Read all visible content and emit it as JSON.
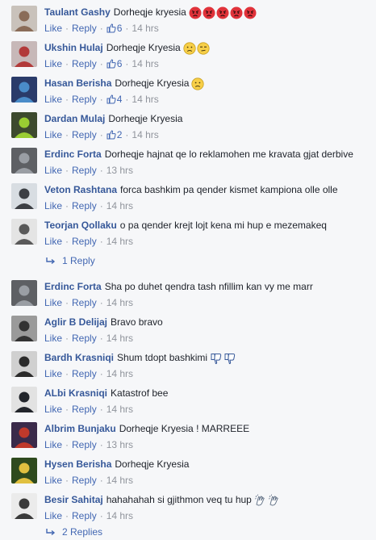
{
  "comments": [
    {
      "author": "Taulant Gashy",
      "text": "Dorheqje kryesia",
      "emojis": [
        "angry",
        "angry",
        "angry",
        "angry",
        "angry"
      ],
      "likes": "6",
      "time": "14 hrs",
      "avatar_bg": "#c9c2bb",
      "avatar_fg": "#8a6c58"
    },
    {
      "author": "Ukshin Hulaj",
      "text": "Dorheqje Kryesia",
      "emojis": [
        "sad",
        "unamused"
      ],
      "likes": "6",
      "time": "14 hrs",
      "avatar_bg": "#c7b8b8",
      "avatar_fg": "#b23a3a"
    },
    {
      "author": "Hasan Berisha",
      "text": "Dorheqje Kryesia",
      "emojis": [
        "sad"
      ],
      "likes": "4",
      "time": "14 hrs",
      "avatar_bg": "#2a3b6a",
      "avatar_fg": "#4a8cc9"
    },
    {
      "author": "Dardan Mulaj",
      "text": "Dorheqje Kryesia",
      "emojis": [],
      "likes": "2",
      "time": "14 hrs",
      "avatar_bg": "#3d4a2e",
      "avatar_fg": "#9acd32"
    },
    {
      "author": "Erdinc Forta",
      "text": "Dorheqje hajnat qe lo reklamohen me kravata gjat derbive",
      "emojis": [],
      "likes": "",
      "time": "13 hrs",
      "avatar_bg": "#5e6064",
      "avatar_fg": "#9a9ea4"
    },
    {
      "author": "Veton Rashtana",
      "text": "forca bashkim pa qender kismet kampiona olle olle",
      "emojis": [],
      "likes": "",
      "time": "14 hrs",
      "avatar_bg": "#d8dde2",
      "avatar_fg": "#3c3f44"
    },
    {
      "author": "Teorjan Qollaku",
      "text": "o pa qender krejt lojt kena mi hup e mezemakeq",
      "emojis": [],
      "likes": "",
      "time": "14 hrs",
      "avatar_bg": "#e4e4e4",
      "avatar_fg": "#5a5a5a"
    },
    {
      "author": "Erdinc Forta",
      "text": "Sha po duhet qendra tash nfillim kan vy me marr",
      "emojis": [],
      "likes": "",
      "time": "14 hrs",
      "avatar_bg": "#5e6064",
      "avatar_fg": "#9a9ea4"
    },
    {
      "author": "Aglir B Delijaj",
      "text": "Bravo bravo",
      "emojis": [],
      "likes": "",
      "time": "14 hrs",
      "avatar_bg": "#9a9a9a",
      "avatar_fg": "#333333"
    },
    {
      "author": "Bardh Krasniqi",
      "text": "Shum tdopt bashkimi",
      "emojis": [
        "thumbsdown",
        "thumbsdown"
      ],
      "likes": "",
      "time": "14 hrs",
      "avatar_bg": "#d0d0d0",
      "avatar_fg": "#2b2b2b"
    },
    {
      "author": "ALbi Krasniqi",
      "text": "Katastrof bee",
      "emojis": [],
      "likes": "",
      "time": "14 hrs",
      "avatar_bg": "#e2e2e2",
      "avatar_fg": "#22252b"
    },
    {
      "author": "Albrim Bunjaku",
      "text": "Dorheqje Kryesia ! MARREEE",
      "emojis": [],
      "likes": "",
      "time": "13 hrs",
      "avatar_bg": "#3a2a4a",
      "avatar_fg": "#c0392b"
    },
    {
      "author": "Hysen Berisha",
      "text": "Dorheqje Kryesia",
      "emojis": [],
      "likes": "",
      "time": "14 hrs",
      "avatar_bg": "#2e4a1e",
      "avatar_fg": "#e0c040"
    },
    {
      "author": "Besir Sahitaj",
      "text": "hahahahah si gjithmon veq tu hup",
      "emojis": [
        "clap",
        "clap"
      ],
      "likes": "",
      "time": "14 hrs",
      "avatar_bg": "#ebebeb",
      "avatar_fg": "#3a3a3a"
    }
  ],
  "actions": {
    "like": "Like",
    "reply": "Reply"
  },
  "reply_links": {
    "after_teorjan": "1 Reply",
    "after_besir": "2 Replies"
  },
  "colors": {
    "author": "#365899",
    "link": "#4267b2",
    "meta": "#90949c",
    "background": "#f6f7f9",
    "angry_emoji": "#e0323a",
    "emoji_yellow": "#f7cf48"
  }
}
